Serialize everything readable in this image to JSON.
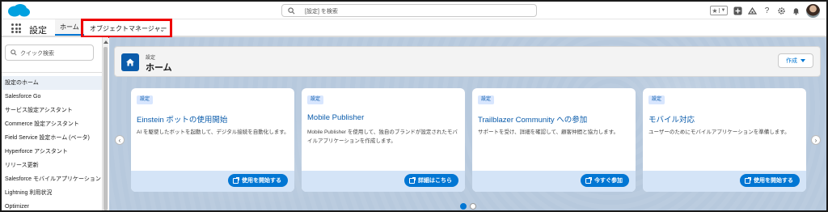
{
  "header": {
    "search_placeholder": "[設定] を検索",
    "icons": [
      "favorites-star-icon",
      "favorites-dropdown-icon",
      "global-actions-add-icon",
      "trailhead-icon",
      "help-icon",
      "setup-gear-icon",
      "notifications-bell-icon",
      "user-avatar"
    ]
  },
  "nav": {
    "app_name": "設定",
    "home_tab": "ホーム",
    "object_manager_tab": "オブジェクトマネージャー",
    "highlight_color": "#e00000"
  },
  "sidebar": {
    "quick_search_placeholder": "クイック検索",
    "items": [
      {
        "label": "設定のホーム",
        "active": true
      },
      {
        "label": "Salesforce Go"
      },
      {
        "label": "サービス設定アシスタント"
      },
      {
        "label": "Commerce 設定アシスタント"
      },
      {
        "label": "Field Service 設定ホーム (ベータ)"
      },
      {
        "label": "Hyperforce アシスタント"
      },
      {
        "label": "リリース更新"
      },
      {
        "label": "Salesforce モバイルアプリケーション"
      },
      {
        "label": "Lightning 利用状況"
      },
      {
        "label": "Optimizer"
      }
    ]
  },
  "page_header": {
    "breadcrumb": "設定",
    "title": "ホーム",
    "create_button": "作成"
  },
  "cards": [
    {
      "tag": "設定",
      "title": "Einstein ボットの使用開始",
      "desc": "AI を駆使したボットを起動して、デジタル接続を自動化します。",
      "button": "使用を開始する"
    },
    {
      "tag": "設定",
      "title": "Mobile Publisher",
      "desc": "Mobile Publisher を使用して、独自のブランドが設定されたモバイルアプリケーションを作成します。",
      "button": "詳細はこちら"
    },
    {
      "tag": "設定",
      "title": "Trailblazer Community への参加",
      "desc": "サポートを受け、詳細を確認して、顧客仲間と協力します。",
      "button": "今すぐ参加"
    },
    {
      "tag": "設定",
      "title": "モバイル対応",
      "desc": "ユーザーのためにモバイルアプリケーションを準備します。",
      "button": "使用を開始する"
    }
  ],
  "carousel": {
    "pages": 2,
    "active_page": 1
  },
  "colors": {
    "brand_blue": "#0176d3",
    "title_blue": "#0b5cab",
    "background": "#b7c9dd"
  }
}
